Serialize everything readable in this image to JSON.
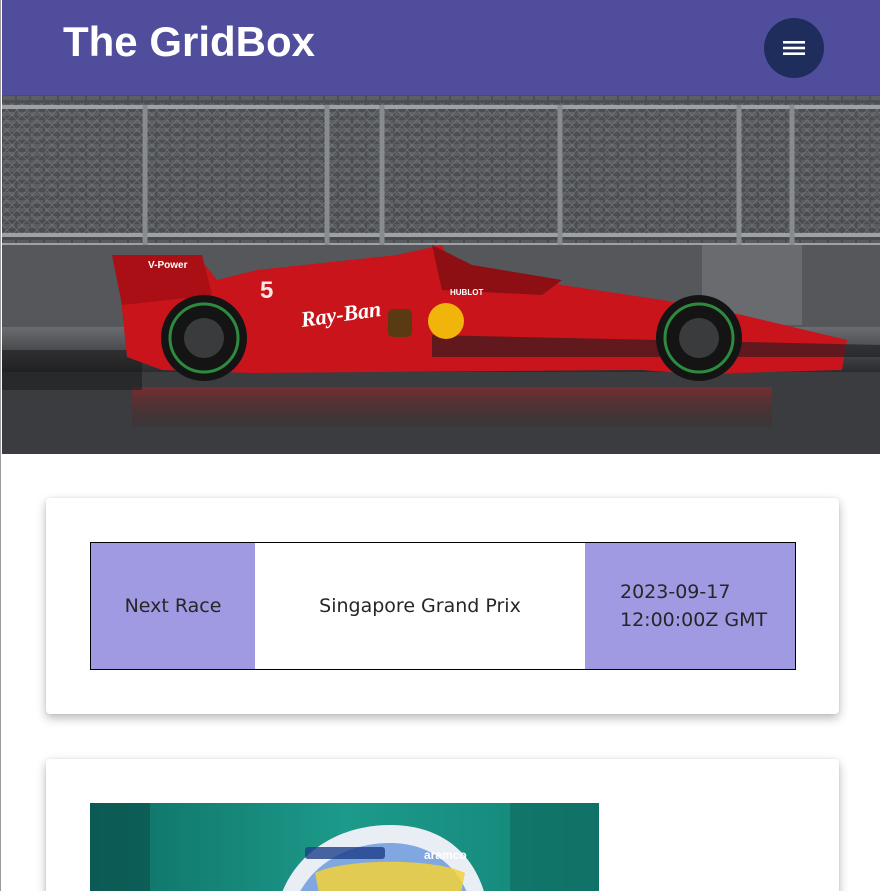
{
  "header": {
    "title": "The GridBox",
    "menu_icon": "hamburger-menu-icon",
    "background": "#4f4d9c",
    "menu_button_color": "#1e2d5c"
  },
  "hero": {
    "image": "red-formula-one-car-on-wet-track"
  },
  "next_race": {
    "label": "Next Race",
    "name": "Singapore Grand Prix",
    "date": "2023-09-17",
    "time": "12:00:00Z GMT",
    "highlight_color": "#9f9ae2"
  },
  "second_card": {
    "image": "driver-helmet-photo"
  }
}
